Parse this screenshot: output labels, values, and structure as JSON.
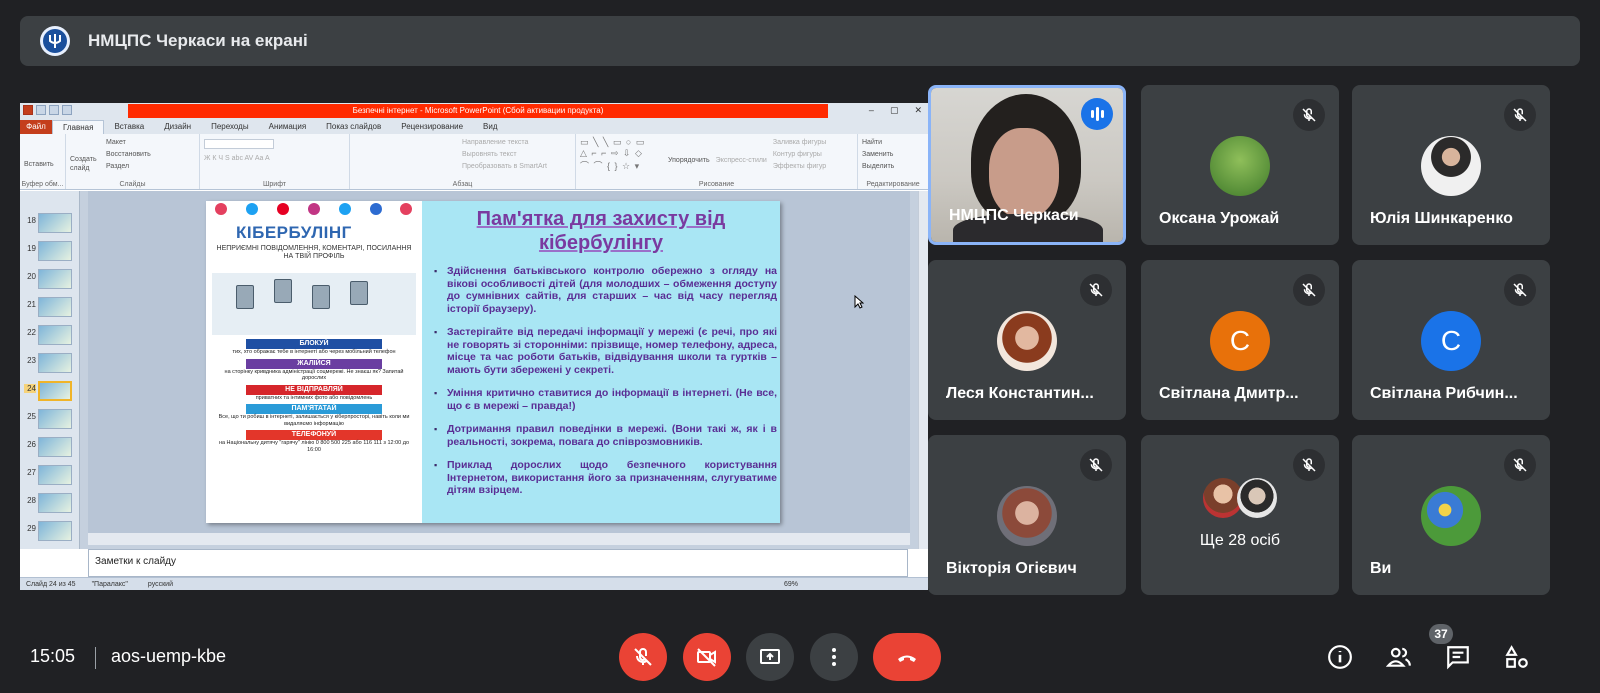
{
  "banner": {
    "title": "НМЦПС Черкаси на екрані",
    "logo_icon": "psi-logo-icon"
  },
  "powerpoint": {
    "window_title": "Безпечні інтернет - Microsoft PowerPoint (Сбой активации продукта)",
    "tabs": [
      "Файл",
      "Главная",
      "Вставка",
      "Дизайн",
      "Переходы",
      "Анимация",
      "Показ слайдов",
      "Рецензирование",
      "Вид"
    ],
    "active_tab": "Главная",
    "ribbon": {
      "clipboard": {
        "paste": "Вставить",
        "label": "Буфер обм..."
      },
      "slides": {
        "create": "Создать слайд",
        "layout": "Макет",
        "reset": "Восстановить",
        "section": "Раздел",
        "label": "Слайды"
      },
      "font": {
        "label": "Шрифт"
      },
      "paragraph": {
        "direction": "Направление текста",
        "align": "Выровнять текст",
        "smartart": "Преобразовать в SmartArt",
        "label": "Абзац"
      },
      "drawing": {
        "arrange": "Упорядочить",
        "styles": "Экспресс-стили",
        "fill": "Заливка фигуры",
        "outline": "Контур фигуры",
        "effects": "Эффекты фигур",
        "label": "Рисование"
      },
      "editing": {
        "find": "Найти",
        "replace": "Заменить",
        "select": "Выделить",
        "label": "Редактирование"
      }
    },
    "thumbnails": [
      "18",
      "19",
      "20",
      "21",
      "22",
      "23",
      "24",
      "25",
      "26",
      "27",
      "28",
      "29"
    ],
    "selected_slide": "24",
    "slide": {
      "left_title": "КІБЕРБУЛІНГ",
      "left_subtitle": "НЕПРИЄМНІ ПОВІДОМЛЕННЯ, КОМЕНТАРІ, ПОСИЛАННЯ НА ТВІЙ ПРОФІЛЬ",
      "left_items": [
        {
          "bar": "БЛОКУЙ",
          "text": "тих, хто ображає тебе в інтернеті або через мобільний телефон",
          "color": "#1f4fa3"
        },
        {
          "bar": "ЖАЛІЙСЯ",
          "text": "на сторінку кривдника адміністрації соцмережі. Не знаєш як? Запитай дорослих",
          "color": "#6a3ea1"
        },
        {
          "bar": "НЕ ВІДПРАВЛЯЙ",
          "text": "приватних та інтимних фото або повідомлень",
          "color": "#d6262b"
        },
        {
          "bar": "ПАМ'ЯТАТАЙ",
          "text": "Все, що ти робиш в інтернеті, залишається у кіберпросторі, навіть коли ми видаляємо інформацію",
          "color": "#2a9bd8"
        },
        {
          "bar": "ТЕЛЕФОНУЙ",
          "text": "на Національну дитячу \"гарячу\" лінію 0 800 500 225 або 116 111 з 12:00 до 16:00",
          "color": "#e3362a"
        }
      ],
      "right_title": "Пам'ятка для захисту від кібербулінгу",
      "bullets": [
        "Здійснення батьківського контролю обережно з огляду на вікові особливості дітей (для молодших – обмеження доступу до сумнівних сайтів, для старших – час від часу перегляд історії браузеру).",
        "Застерігайте від передачі інформації у мережі (є речі, про які не говорять зі сторонніми: прізвище, номер телефону, адреса, місце та час роботи батьків, відвідування школи та гуртків – мають бути збережені у секреті.",
        "Уміння критично ставитися до інформації в інтернеті. (Не все, що є в мережі – правда!)",
        "Дотримання правил поведінки в мережі. (Вони такі ж, як і в реальності, зокрема, повага до співрозмовників.",
        "Приклад дорослих щодо безпечного користування Інтернетом, використання його за призначенням, слугуватиме дітям взірцем."
      ]
    },
    "notes_placeholder": "Заметки к слайду",
    "status": {
      "slide": "Слайд 24 из 45",
      "theme": "\"Паралакс\"",
      "language": "русский",
      "zoom": "69%"
    }
  },
  "participants": [
    {
      "name": "НМЦПС Черкаси",
      "speaking": true
    },
    {
      "name": "Оксана Урожай",
      "muted": true
    },
    {
      "name": "Юлія Шинкаренко",
      "muted": true
    },
    {
      "name": "Леся Константин...",
      "muted": true
    },
    {
      "name": "Світлана Дмитр...",
      "muted": true,
      "initial": "С",
      "color": "#e8710a"
    },
    {
      "name": "Світлана Рибчин...",
      "muted": true,
      "initial": "С",
      "color": "#1a73e8"
    },
    {
      "name": "Вікторія Огієвич",
      "muted": true
    },
    {
      "name": "Ще 28 осіб",
      "muted": true
    },
    {
      "name": "Ви",
      "muted": true
    }
  ],
  "bottom_bar": {
    "time": "15:05",
    "meeting_code": "aos-uemp-kbe",
    "participants_count": "37"
  }
}
